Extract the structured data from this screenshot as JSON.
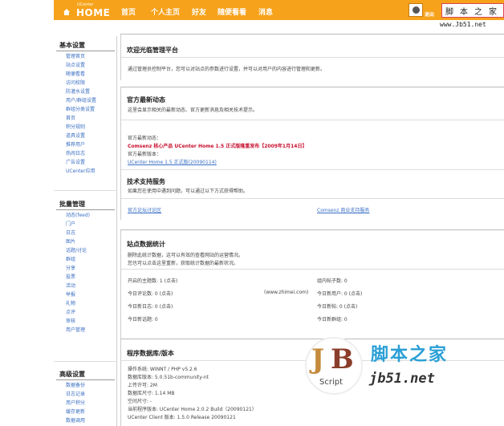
{
  "header": {
    "logo_top": "UCenter",
    "logo_main": "HOME",
    "nav": [
      "首页",
      "个人主页",
      "好友",
      "随便看看",
      "消息"
    ],
    "logout": "退出",
    "watermark_cn": [
      "脚",
      "本",
      "之",
      "家"
    ],
    "watermark_url": "www.Jb51.net"
  },
  "sidebar": {
    "groups": [
      {
        "title": "基本设置",
        "items": [
          "管理首页",
          "站点设置",
          "随便看看",
          "访问权限",
          "防灌水设置",
          "用户/群组设置",
          "群组分类设置",
          "首页",
          "积分规则",
          "道具设置",
          "推荐用户",
          "热闹日志",
          "广告设置",
          "UCenter应用"
        ]
      },
      {
        "title": "批量管理",
        "items": [
          "动态(feed)",
          "门户",
          "日志",
          "图片",
          "话题/讨论",
          "群组",
          "分享",
          "投票",
          "活动",
          "举报",
          "礼物",
          "点评",
          "审核",
          "用户管理"
        ]
      },
      {
        "title": "高级设置",
        "items": [
          "数据备份",
          "日志记录",
          "用户积分",
          "缓存更新",
          "数据调用"
        ]
      }
    ]
  },
  "welcome": {
    "title": "欢迎光临管理平台",
    "text": "通过管理员控制平台，您可以对站点的参数进行设置，并可以对用户的内容进行管理和更新。"
  },
  "news": {
    "title": "官方最新动态",
    "subtitle": "这里会显示相关的最新动态、官方更新消息及相关技术提示。",
    "label1": "官方最新动态：",
    "headline": "Comsenz 核心产品 UCenter Home 1.5 正式版隆重发布【2009年1月14日】",
    "label2": "官方最新版本：",
    "version_link": "UCenter Home 1.5 正式版(20090114)",
    "support_title": "技术支持服务",
    "support_text": "如果您在使用中遇到问题，可以通过以下方式获得帮助。",
    "link1": "官方论坛讨论区",
    "link2": "Comsenz 商业支持服务"
  },
  "stats": {
    "title": "站点数据统计",
    "desc1": "删除此统计数据，这可以有效的查看网站的运营情况。",
    "desc2": "您也可以点击这里重新，获取统计数据的最新状况。",
    "rows": [
      [
        "开启的主题数: 1 (点击)",
        "组内帖子数: 0"
      ],
      [
        "今日评论数: 0 (点击)",
        "今日新用户: 0 (点击)"
      ],
      [
        "今日新日志: 0 (点击)",
        "今日新帖: 0 (点击)"
      ],
      [
        "今日新话题: 0",
        "今日新群组: 0"
      ]
    ],
    "middle_text": "(www.zhimei.com)"
  },
  "system": {
    "title": "程序数据库/版本",
    "rows": [
      "操作系统: WINNT / PHP v5.2.6",
      "数据库版本: 5.0.51b-community-nt",
      "上传许可: 2M",
      "数据库尺寸: 1.14 MB",
      "空间尺寸: -",
      "当前程序版本: UCenter Home 2.0.2 Build（20090121）",
      "UCenter Client 版本: 1.5.0 Release 20090121"
    ]
  },
  "watermark": {
    "badge_j": "J",
    "badge_b": "B",
    "badge_script": "Script",
    "cn": "脚本之家",
    "net": "jb51.net"
  }
}
